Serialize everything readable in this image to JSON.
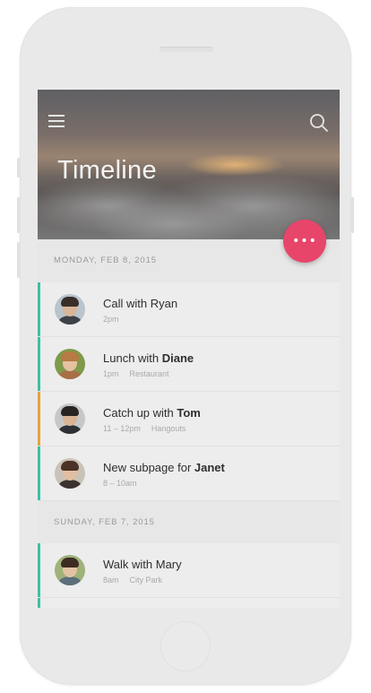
{
  "header": {
    "title": "Timeline",
    "menu_icon": "menu-icon",
    "search_icon": "search-icon"
  },
  "fab": {
    "label": "•••",
    "icon": "more-icon",
    "color": "#e8456b"
  },
  "sections": [
    {
      "date": "MONDAY, FEB 8, 2015",
      "events": [
        {
          "title": "Call with ",
          "name": "Ryan",
          "name_bold": false,
          "time": "2pm",
          "location": "",
          "accent": "#3dbfa6"
        },
        {
          "title": "Lunch with ",
          "name": "Diane",
          "name_bold": true,
          "time": "1pm",
          "location": "Restaurant",
          "accent": "#3dbfa6"
        },
        {
          "title": "Catch up with ",
          "name": "Tom",
          "name_bold": true,
          "time": "11 – 12pm",
          "location": "Hangouts",
          "accent": "#e8a23a"
        },
        {
          "title": "New subpage for ",
          "name": "Janet",
          "name_bold": true,
          "time": "8 – 10am",
          "location": "",
          "accent": "#3dbfa6"
        }
      ]
    },
    {
      "date": "SUNDAY, FEB 7, 2015",
      "events": [
        {
          "title": "Walk with ",
          "name": "Mary",
          "name_bold": false,
          "time": "8am",
          "location": "City Park",
          "accent": "#3dbfa6"
        }
      ]
    }
  ]
}
